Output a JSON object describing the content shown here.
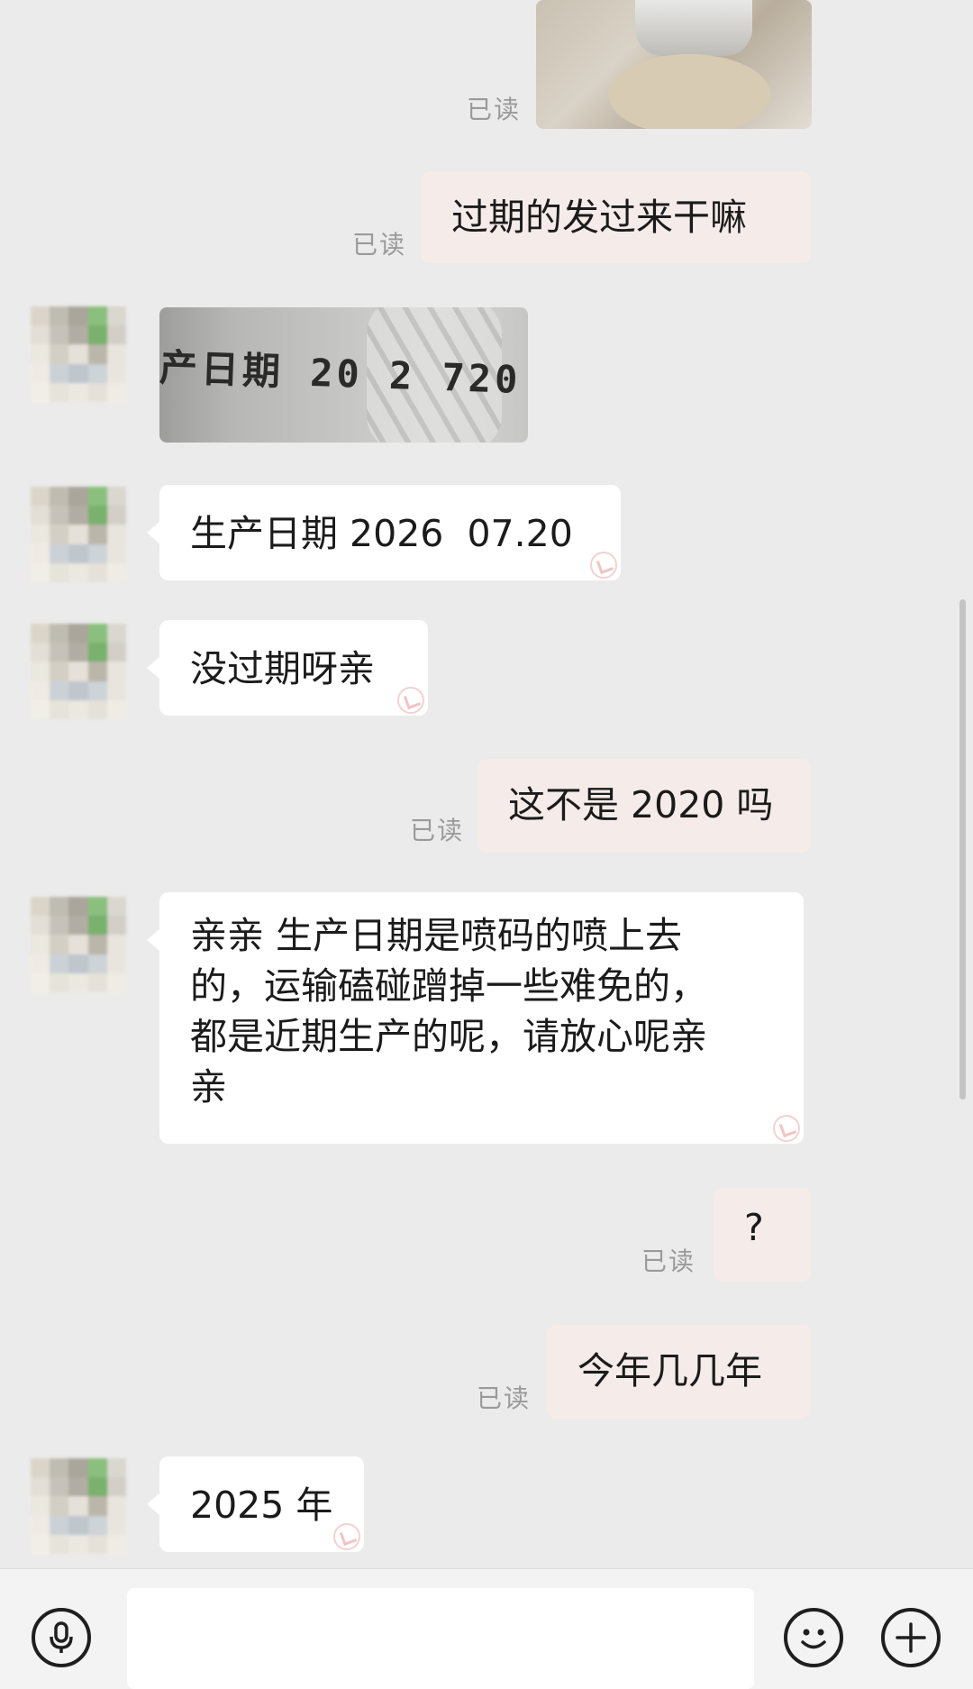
{
  "read_label": "已读",
  "messages": [
    {
      "id": "m1",
      "dir": "out",
      "type": "image",
      "desc": "product photo"
    },
    {
      "id": "m2",
      "dir": "out",
      "type": "text",
      "text": "过期的发过来干嘛"
    },
    {
      "id": "m3",
      "dir": "in",
      "type": "image",
      "print_text": "产日期 20 2 720"
    },
    {
      "id": "m4",
      "dir": "in",
      "type": "text",
      "text": "生产日期 2026  07.20"
    },
    {
      "id": "m5",
      "dir": "in",
      "type": "text",
      "text": "没过期呀亲"
    },
    {
      "id": "m6",
      "dir": "out",
      "type": "text",
      "text": "这不是 2020 吗"
    },
    {
      "id": "m7",
      "dir": "in",
      "type": "text",
      "lines": [
        "亲亲  生产日期是喷码的喷上去",
        "的，运输磕碰蹭掉一些难免的，",
        "都是近期生产的呢，请放心呢亲",
        "亲"
      ]
    },
    {
      "id": "m8",
      "dir": "out",
      "type": "text",
      "text": "?"
    },
    {
      "id": "m9",
      "dir": "out",
      "type": "text",
      "text": "今年几几年"
    },
    {
      "id": "m10",
      "dir": "in",
      "type": "text",
      "text": "2025 年"
    }
  ],
  "input_bar": {
    "placeholder": "",
    "icons": [
      "microphone-icon",
      "emoji-icon",
      "plus-icon"
    ]
  }
}
